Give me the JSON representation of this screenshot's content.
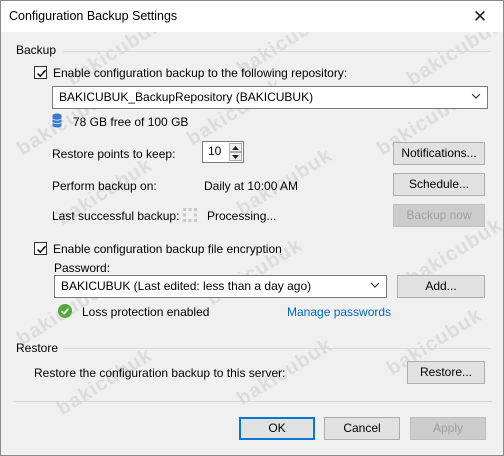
{
  "window": {
    "title": "Configuration Backup Settings",
    "close_glyph": "✕"
  },
  "backup": {
    "section_label": "Backup",
    "enable_checkbox_label": "Enable configuration backup to the following repository:",
    "repository_value": "BAKICUBUK_BackupRepository (BAKICUBUK)",
    "free_space": "78 GB free of 100 GB",
    "restore_points_label": "Restore points to keep:",
    "restore_points_value": "10",
    "notifications_button": "Notifications...",
    "perform_backup_label": "Perform backup on:",
    "schedule_value": "Daily at 10:00 AM",
    "schedule_button": "Schedule...",
    "last_backup_label": "Last successful backup:",
    "last_backup_status": "Processing...",
    "backup_now_button": "Backup now",
    "encryption_checkbox_label": "Enable configuration backup file encryption",
    "password_label": "Password:",
    "password_value": "BAKICUBUK (Last edited: less than a day ago)",
    "add_button": "Add...",
    "loss_protection_text": "Loss protection enabled",
    "manage_passwords_link": "Manage passwords"
  },
  "restore": {
    "section_label": "Restore",
    "restore_text": "Restore the configuration backup to this server:",
    "restore_button": "Restore..."
  },
  "footer": {
    "ok_button": "OK",
    "cancel_button": "Cancel",
    "apply_button": "Apply"
  },
  "watermark_text": "bakicubuk",
  "icons": {
    "database": "database-icon",
    "processing": "processing-icon",
    "check_circle": "check-circle-icon"
  },
  "colors": {
    "accent": "#0078d7",
    "link": "#0066cc",
    "success": "#53a83b",
    "db": "#3a7ac8"
  }
}
